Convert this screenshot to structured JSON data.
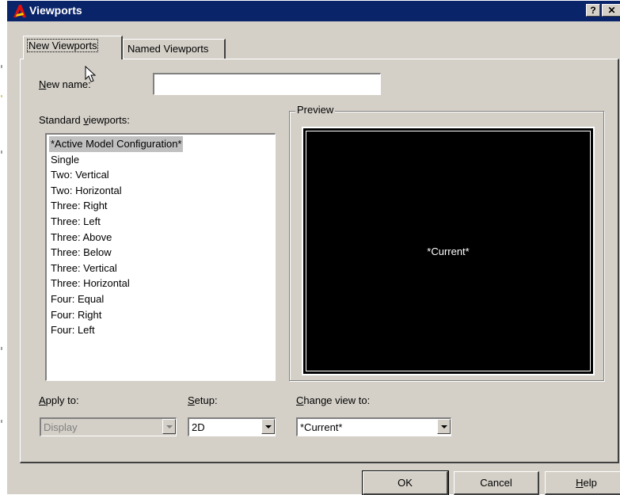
{
  "window": {
    "title": "Viewports",
    "help_label": "?",
    "close_label": "✕"
  },
  "tabs": [
    {
      "label": "New Viewports",
      "active": true
    },
    {
      "label": "Named Viewports",
      "active": false
    }
  ],
  "new_name": {
    "prefix": "N",
    "rest": "ew name:",
    "value": ""
  },
  "standard_viewports": {
    "label_prefix": "Standard ",
    "label_ul": "v",
    "label_rest": "iewports:",
    "items": [
      "*Active Model Configuration*",
      "Single",
      "Two:  Vertical",
      "Two:  Horizontal",
      "Three: Right",
      "Three: Left",
      "Three: Above",
      "Three: Below",
      "Three: Vertical",
      "Three: Horizontal",
      "Four:  Equal",
      "Four:  Right",
      "Four:  Left"
    ],
    "selected_index": 0
  },
  "preview": {
    "legend": "Preview",
    "label": "*Current*"
  },
  "apply_to": {
    "ul": "A",
    "rest": "pply to:",
    "value": "Display",
    "disabled": true
  },
  "setup": {
    "ul": "S",
    "rest": "etup:",
    "value": "2D"
  },
  "change_view": {
    "ul": "C",
    "rest": "hange view to:",
    "value": "*Current*"
  },
  "buttons": {
    "ok": "OK",
    "cancel": "Cancel",
    "help_ul": "H",
    "help_rest": "elp"
  },
  "icons": {
    "app": "autocad-logo-icon",
    "cursor": "mouse-pointer-icon"
  }
}
